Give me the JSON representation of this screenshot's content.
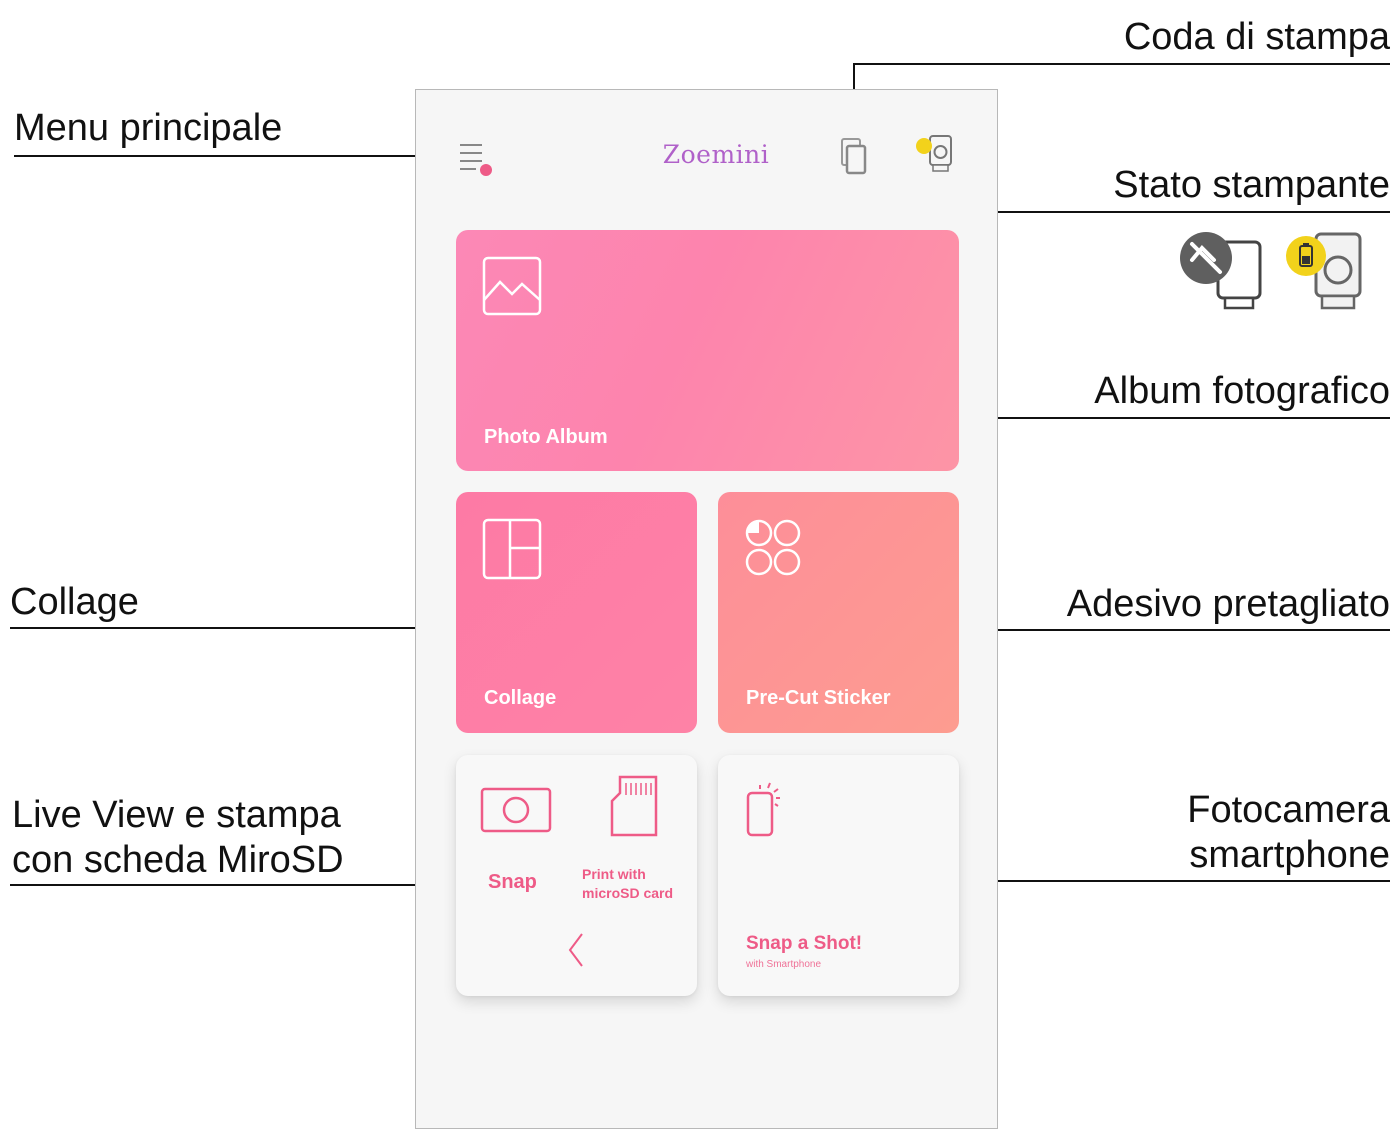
{
  "callouts": {
    "print_queue": "Coda di stampa",
    "main_menu": "Menu principale",
    "printer_status": "Stato stampante",
    "photo_album": "Album fotografico",
    "collage": "Collage",
    "pre_cut_sticker": "Adesivo pretagliato",
    "live_view_line1": "Live View e stampa",
    "live_view_line2": "con scheda MiroSD",
    "phone_camera_line1": "Fotocamera",
    "phone_camera_line2": "smartphone"
  },
  "app": {
    "title": "Zoemini",
    "cards": {
      "photo_album": "Photo Album",
      "collage": "Collage",
      "pre_cut_sticker": "Pre-Cut Sticker",
      "snap": "Snap",
      "print_microsd_line1": "Print with",
      "print_microsd_line2": "microSD card",
      "snap_a_shot": "Snap a Shot!",
      "snap_a_shot_sub": "with Smartphone"
    }
  },
  "colors": {
    "accent_pink": "#ee5b87",
    "title_purple": "#b061c9",
    "battery_yellow": "#f2d21b",
    "disconnected_gray": "#5f5f5f"
  },
  "icons": [
    "menu-icon",
    "print-queue-icon",
    "printer-status-icon",
    "disconnected-printer-icon",
    "battery-printer-icon",
    "image-icon",
    "collage-layout-icon",
    "sticker-shapes-icon",
    "camera-icon",
    "microsd-card-icon",
    "chevron-left-icon",
    "smartphone-icon"
  ]
}
